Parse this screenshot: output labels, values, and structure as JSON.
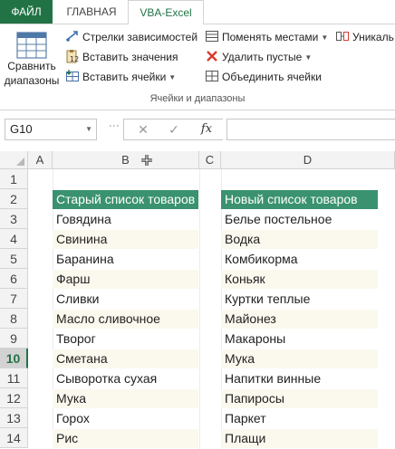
{
  "ribbon": {
    "tabs": [
      {
        "label": "ФАЙЛ"
      },
      {
        "label": "ГЛАВНАЯ"
      },
      {
        "label": "VBA-Excel"
      }
    ],
    "compare_button": {
      "line1": "Сравнить",
      "line2": "диапазоны"
    },
    "col1": [
      {
        "label": "Стрелки зависимостей",
        "icon": "arrows-icon"
      },
      {
        "label": "Вставить значения",
        "icon": "paste-values-icon"
      },
      {
        "label": "Вставить ячейки",
        "icon": "insert-cells-icon",
        "dropdown": true
      }
    ],
    "col2": [
      {
        "label": "Поменять местами",
        "icon": "swap-icon",
        "dropdown": true
      },
      {
        "label": "Удалить пустые",
        "icon": "delete-empty-icon",
        "dropdown": true
      },
      {
        "label": "Объединить ячейки",
        "icon": "merge-cells-icon"
      }
    ],
    "col3": [
      {
        "label": "Уникаль",
        "icon": "unique-icon"
      }
    ],
    "group_label": "Ячейки и диапазоны",
    "accent_color": "#217346"
  },
  "formula_bar": {
    "name_box": "G10",
    "cancel_icon": "✕",
    "enter_icon": "✓",
    "fx_label": "fx",
    "content": ""
  },
  "sheet": {
    "columns": [
      "A",
      "B",
      "C",
      "D"
    ],
    "rows": [
      "1",
      "2",
      "3",
      "4",
      "5",
      "6",
      "7",
      "8",
      "9",
      "10",
      "11",
      "12",
      "13",
      "14"
    ],
    "selected_row": "10",
    "header_color": "#3a9270",
    "band_color": "#fbf8ee",
    "old_list": {
      "header": "Старый список товаров",
      "items": [
        "Говядина",
        "Свинина",
        "Баранина",
        "Фарш",
        "Сливки",
        "Масло сливочное",
        "Творог",
        "Сметана",
        "Сыворотка сухая",
        "Мука",
        "Горох",
        "Рис"
      ]
    },
    "new_list": {
      "header": "Новый список товаров",
      "items": [
        "Белье постельное",
        "Водка",
        "Комбикорма",
        "Коньяк",
        "Куртки теплые",
        "Майонез",
        "Макароны",
        "Мука",
        "Напитки винные",
        "Папиросы",
        "Паркет",
        "Плащи"
      ]
    }
  }
}
